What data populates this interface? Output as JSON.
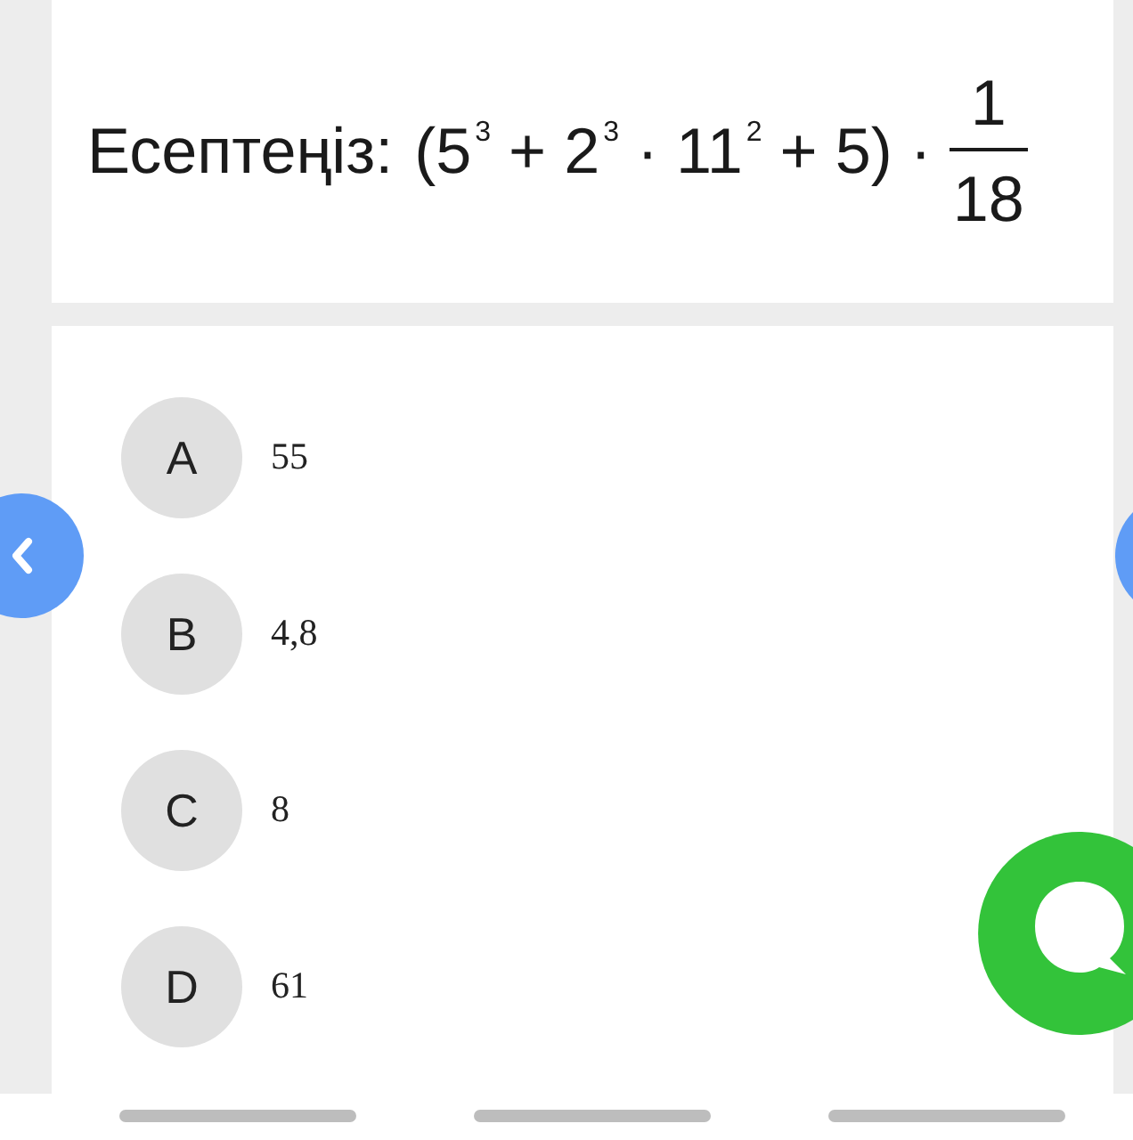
{
  "question": {
    "prompt": "Есептеңіз:",
    "expression": "(5$^{3}$ + 2$^{3}$ · 11$^{2}$ + 5) ·",
    "fraction": {
      "numerator": "1",
      "denominator": "18"
    }
  },
  "options": [
    {
      "letter": "A",
      "value": "55"
    },
    {
      "letter": "B",
      "value": "4,8"
    },
    {
      "letter": "C",
      "value": "8"
    },
    {
      "letter": "D",
      "value": "61"
    }
  ]
}
